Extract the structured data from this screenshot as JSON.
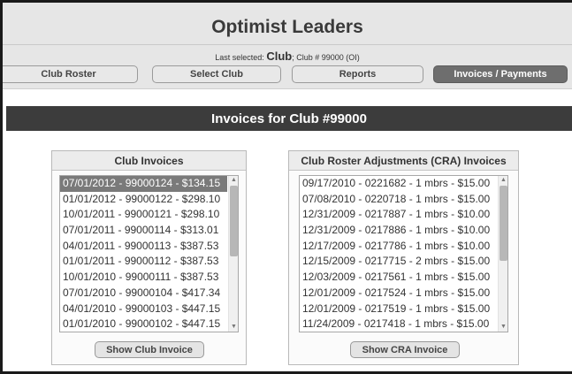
{
  "header": {
    "title": "Optimist Leaders",
    "last_selected_prefix": "Last selected:",
    "last_selected_club": "Club",
    "last_selected_suffix": "; Club # 99000 (OI)"
  },
  "nav": {
    "club_roster": "Club Roster",
    "select_club": "Select Club",
    "reports": "Reports",
    "invoices_payments": "Invoices / Payments"
  },
  "section": {
    "title": "Invoices for Club #99000"
  },
  "club_invoices": {
    "heading": "Club Invoices",
    "items": [
      "07/01/2012 - 99000124 - $134.15",
      "01/01/2012 - 99000122 - $298.10",
      "10/01/2011 - 99000121 - $298.10",
      "07/01/2011 - 99000114 - $313.01",
      "04/01/2011 - 99000113 - $387.53",
      "01/01/2011 - 99000112 - $387.53",
      "10/01/2010 - 99000111 - $387.53",
      "07/01/2010 - 99000104 - $417.34",
      "04/01/2010 - 99000103 - $447.15",
      "01/01/2010 - 99000102 - $447.15"
    ],
    "button": "Show Club Invoice"
  },
  "cra_invoices": {
    "heading": "Club Roster Adjustments (CRA) Invoices",
    "items": [
      "09/17/2010 - 0221682 - 1 mbrs - $15.00",
      "07/08/2010 - 0220718 - 1 mbrs - $15.00",
      "12/31/2009 - 0217887 - 1 mbrs - $10.00",
      "12/31/2009 - 0217886 - 1 mbrs - $10.00",
      "12/17/2009 - 0217786 - 1 mbrs - $10.00",
      "12/15/2009 - 0217715 - 2 mbrs - $15.00",
      "12/03/2009 - 0217561 - 1 mbrs - $15.00",
      "12/01/2009 - 0217524 - 1 mbrs - $15.00",
      "12/01/2009 - 0217519 - 1 mbrs - $15.00",
      "11/24/2009 - 0217418 - 1 mbrs - $15.00"
    ],
    "button": "Show CRA Invoice"
  }
}
